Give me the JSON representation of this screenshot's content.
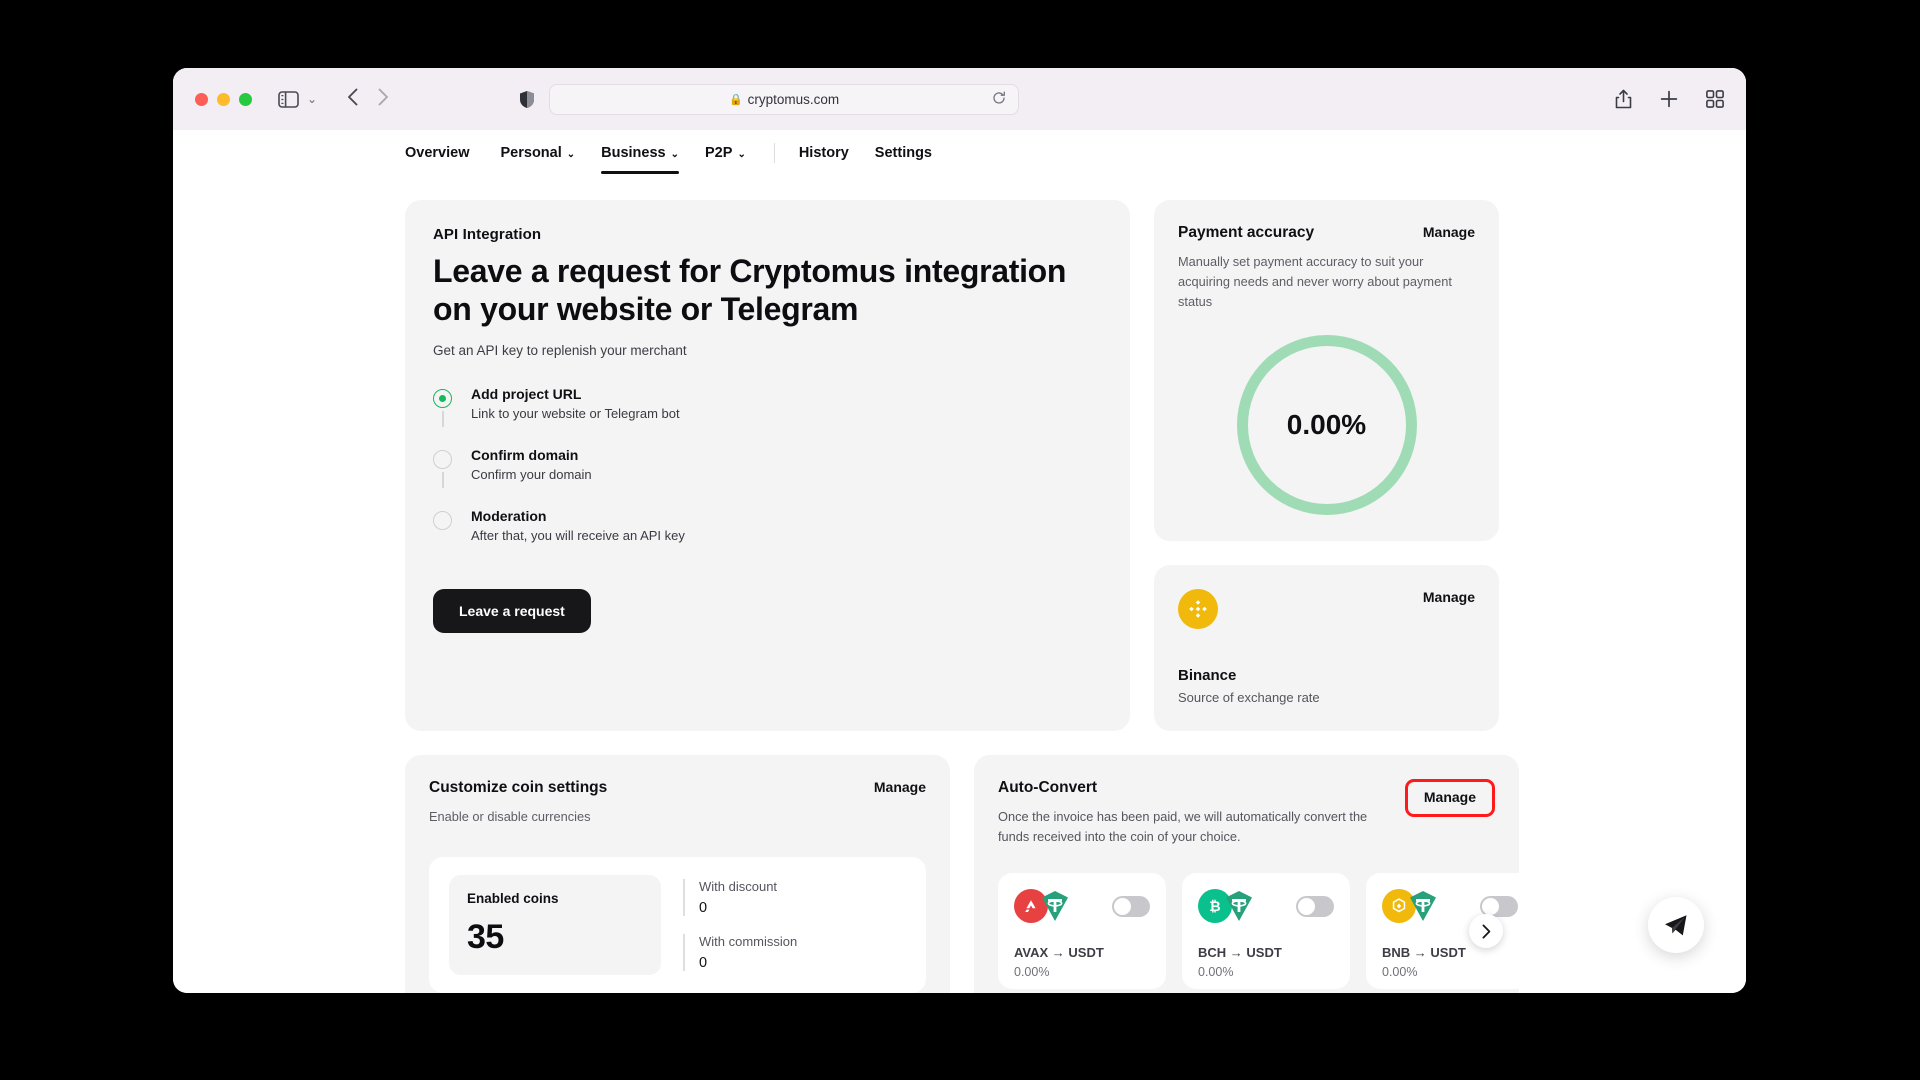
{
  "browser": {
    "url": "cryptomus.com",
    "lock_icon": "lock-icon",
    "reload_icon": "reload-icon",
    "sidebar_icon": "sidebar-toggle-icon",
    "back_icon": "chevron-left-icon",
    "forward_icon": "chevron-right-icon",
    "shield_icon": "shield-icon",
    "share_icon": "share-icon",
    "new_tab_icon": "plus-icon",
    "tab_overview_icon": "grid-icon",
    "caret": "⌄"
  },
  "nav": {
    "items": [
      {
        "label": "Overview",
        "caret": "",
        "active": false
      },
      {
        "label": "Personal",
        "caret": "⌄",
        "active": false
      },
      {
        "label": "Business",
        "caret": "⌄",
        "active": true
      },
      {
        "label": "P2P",
        "caret": "⌄",
        "active": false
      }
    ],
    "items_right": [
      {
        "label": "History"
      },
      {
        "label": "Settings"
      }
    ]
  },
  "api_card": {
    "kicker": "API Integration",
    "title": "Leave a request for Cryptomus integration on your website or Telegram",
    "subtitle": "Get an API key to replenish your merchant",
    "steps": [
      {
        "title": "Add project URL",
        "desc": "Link to your website or Telegram bot",
        "done": true
      },
      {
        "title": "Confirm domain",
        "desc": "Confirm your domain",
        "done": false
      },
      {
        "title": "Moderation",
        "desc": "After that, you will receive an API key",
        "done": false
      }
    ],
    "button": "Leave a request"
  },
  "payment_accuracy": {
    "title": "Payment accuracy",
    "manage": "Manage",
    "desc": "Manually set payment accuracy to suit your acquiring needs and never worry about payment status",
    "value": "0.00%",
    "ring_color": "#9fdcb5"
  },
  "exchange_source": {
    "manage": "Manage",
    "name": "Binance",
    "desc": "Source of exchange rate",
    "icon": "binance-icon",
    "icon_color": "#f0b90b"
  },
  "coin_settings": {
    "title": "Customize coin settings",
    "manage": "Manage",
    "desc": "Enable or disable currencies",
    "enabled_label": "Enabled coins",
    "enabled_value": "35",
    "stats": [
      {
        "label": "With discount",
        "value": "0"
      },
      {
        "label": "With commission",
        "value": "0"
      }
    ]
  },
  "auto_convert": {
    "title": "Auto-Convert",
    "manage": "Manage",
    "manage_highlight_color": "#ff1a1a",
    "desc": "Once the invoice has been paid, we will automatically convert the funds received into the coin of your choice.",
    "next_icon": "chevron-right-icon",
    "pairs": [
      {
        "pair": "AVAX → USDT",
        "percent": "0.00%",
        "from": "AVAX",
        "from_color": "#e84142",
        "to": "USDT",
        "to_color": "#26a17b",
        "enabled": false
      },
      {
        "pair": "BCH → USDT",
        "percent": "0.00%",
        "from": "BCH",
        "from_color": "#0ac18e",
        "to": "USDT",
        "to_color": "#26a17b",
        "enabled": false
      },
      {
        "pair": "BNB → USDT",
        "percent": "0.00%",
        "from": "BNB",
        "from_color": "#f0b90b",
        "to": "USDT",
        "to_color": "#26a17b",
        "enabled": false
      }
    ]
  },
  "fab": {
    "icon": "telegram-icon"
  }
}
